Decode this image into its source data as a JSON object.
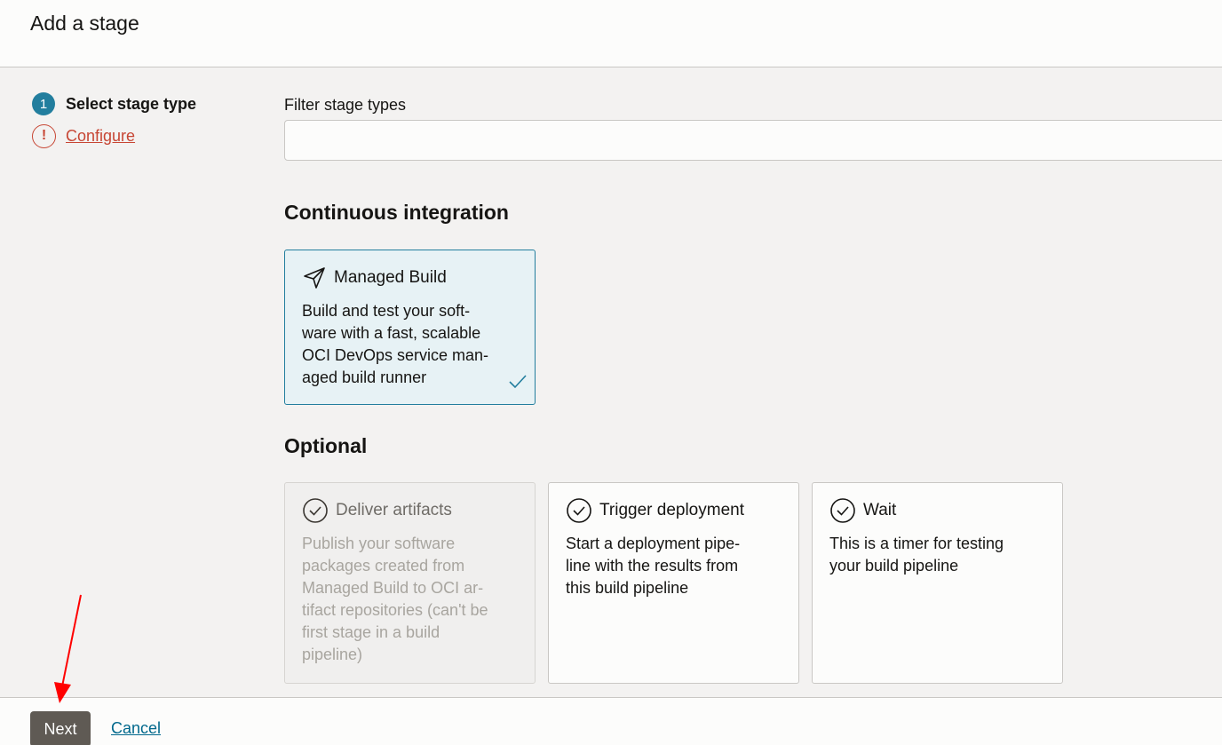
{
  "header": {
    "title": "Add a stage"
  },
  "steps": [
    {
      "number": "1",
      "label": "Select stage type"
    },
    {
      "icon_text": "!",
      "label": "Configure"
    }
  ],
  "filter": {
    "label": "Filter stage types",
    "value": "",
    "placeholder": ""
  },
  "sections": {
    "ci_title": "Continuous integration",
    "optional_title": "Optional"
  },
  "cards": {
    "managed_build": {
      "icon": "paper-plane-icon",
      "title": "Managed Build",
      "desc_lines": [
        "Build and test your soft-",
        "ware with a fast, scalable",
        "OCI DevOps service man-",
        "aged build runner"
      ]
    },
    "deliver_artifacts": {
      "icon": "check-circle-icon",
      "title": "Deliver artifacts",
      "desc_lines": [
        "Publish your software",
        "packages created from",
        "Managed Build to OCI ar-",
        "tifact repositories (can't be",
        "first stage in a build",
        "pipeline)"
      ]
    },
    "trigger_deployment": {
      "icon": "check-circle-icon",
      "title": "Trigger deployment",
      "desc_lines": [
        "Start a deployment pipe-",
        "line with the results from",
        "this build pipeline"
      ]
    },
    "wait": {
      "icon": "check-circle-icon",
      "title": "Wait",
      "desc_lines": [
        "This is a timer for testing",
        "your build pipeline"
      ]
    }
  },
  "footer": {
    "next_label": "Next",
    "cancel_label": "Cancel"
  },
  "colors": {
    "accent": "#227e9e",
    "warning": "#c74634",
    "primary_button": "#5f5a54",
    "link": "#00688c",
    "annotation_arrow": "#ff0000"
  }
}
